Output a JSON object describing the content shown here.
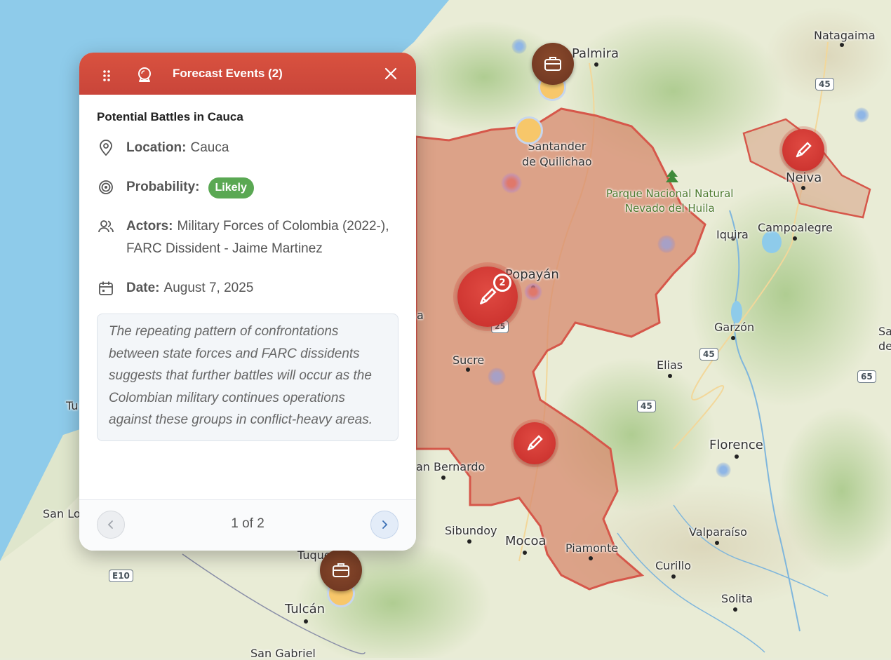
{
  "panel": {
    "title": "Forecast Events (2)",
    "event_title": "Potential Battles in Cauca",
    "location_label": "Location:",
    "location_value": "Cauca",
    "probability_label": "Probability:",
    "probability_value": "Likely",
    "actors_label": "Actors:",
    "actors_value": "Military Forces of Colombia (2022-), FARC Dissident - Jaime Martinez",
    "date_label": "Date:",
    "date_value": "August 7, 2025",
    "summary": "The repeating pattern of confrontations between state forces and FARC dissidents suggests that further battles will occur as the Colombian military continues operations against these groups in conflict-heavy areas.",
    "pager": "1 of 2",
    "colors": {
      "header": "#d14b3c",
      "probability_pill": "#5aa853"
    },
    "icons": [
      "drag-handle-icon",
      "forecast-icon",
      "close-icon",
      "location-pin-icon",
      "target-icon",
      "people-icon",
      "calendar-icon",
      "chevron-left-icon",
      "chevron-right-icon"
    ]
  },
  "map": {
    "places": {
      "natagaima": "Natagaima",
      "palmira": "Palmira",
      "santander": "Santander\nde Quilichao",
      "park": "Parque Nacional Natural\nNevado del Huila",
      "neiva": "Neiva",
      "iquira": "Iquira",
      "campoalegre": "Campoalegre",
      "popayan": "Popayán",
      "garzon": "Garzón",
      "sucre": "Sucre",
      "elias": "Elias",
      "florence": "Florence",
      "sanbernardo": "an Bernardo",
      "sibundoy": "Sibundoy",
      "mocoa": "Mocoa",
      "piamonte": "Piamonte",
      "valparaiso": "Valparaíso",
      "curillo": "Curillo",
      "solita": "Solita",
      "tuquerres": "Tuque",
      "tulcan": "Tulcán",
      "sangabriel": "San Gabriel",
      "sanlorenzo": "San Lo",
      "tu": "Tu",
      "sa": "Sa\nde",
      "a": "a"
    },
    "routes": {
      "r45a": "45",
      "r45b": "45",
      "r45c": "45",
      "r65": "65",
      "r25": "25",
      "rE10": "E10"
    },
    "cluster_count": "2",
    "colors": {
      "cauca_fill": "#d78a6e",
      "cauca_border": "#d6574a",
      "water": "#8ecbea",
      "land": "#e8ecd9"
    }
  }
}
